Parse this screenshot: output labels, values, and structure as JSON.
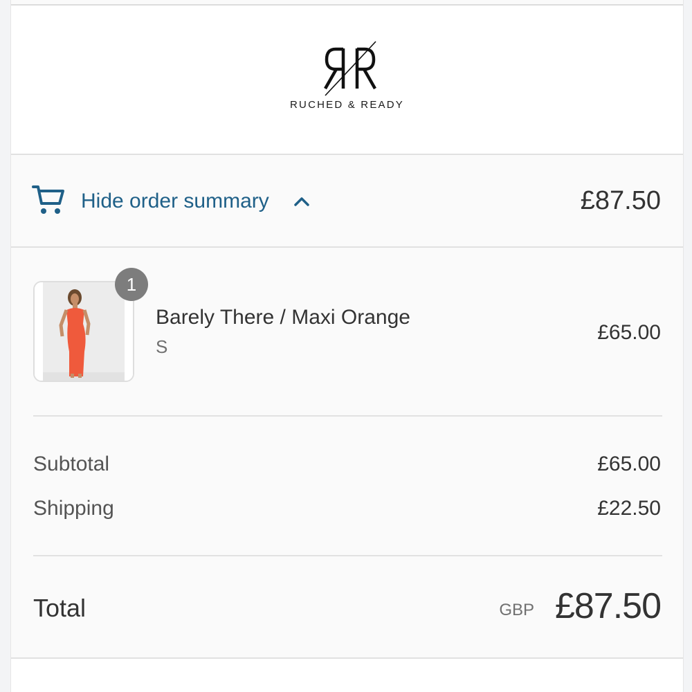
{
  "brand": {
    "name": "RUCHED & READY",
    "logo_icon": "rr-monogram-logo"
  },
  "summary_toggle": {
    "icon": "cart-icon",
    "label": "Hide order summary",
    "chevron_icon": "chevron-up-icon",
    "total": "£87.50"
  },
  "line_items": [
    {
      "quantity": "1",
      "title": "Barely There / Maxi Orange",
      "variant": "S",
      "price": "£65.00",
      "image": "orange-maxi-dress-photo"
    }
  ],
  "costs": {
    "subtotal_label": "Subtotal",
    "subtotal_value": "£65.00",
    "shipping_label": "Shipping",
    "shipping_value": "£22.50"
  },
  "total": {
    "label": "Total",
    "currency": "GBP",
    "value": "£87.50"
  },
  "colors": {
    "link": "#1f6088",
    "text": "#333333",
    "muted": "#707070",
    "badge": "#7d7d7d",
    "background": "#fafafa"
  }
}
